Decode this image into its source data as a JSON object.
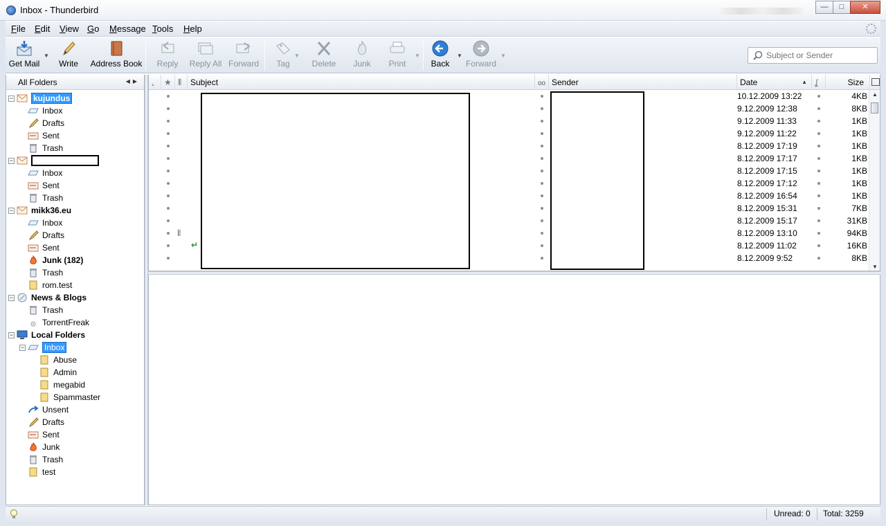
{
  "window": {
    "title": "Inbox - Thunderbird",
    "buttons": {
      "minimize": "—",
      "maximize": "□",
      "close": "✕"
    }
  },
  "menu": [
    {
      "label_u": "F",
      "label_rest": "ile"
    },
    {
      "label_u": "E",
      "label_rest": "dit"
    },
    {
      "label_u": "V",
      "label_rest": "iew"
    },
    {
      "label_u": "G",
      "label_rest": "o"
    },
    {
      "label_u": "M",
      "label_rest": "essage"
    },
    {
      "label_u": "T",
      "label_rest": "ools"
    },
    {
      "label_u": "H",
      "label_rest": "elp"
    }
  ],
  "toolbar": {
    "get_mail": "Get Mail",
    "write": "Write",
    "address_book": "Address Book",
    "reply": "Reply",
    "reply_all": "Reply All",
    "forward": "Forward",
    "tag": "Tag",
    "delete": "Delete",
    "junk": "Junk",
    "print": "Print",
    "back": "Back",
    "forward_nav": "Forward",
    "search_placeholder": "Subject or Sender"
  },
  "folder_pane": {
    "header": "All Folders",
    "tree": [
      {
        "label": "kujundus",
        "icon": "account-mail-icon",
        "bold": true,
        "selected_style": true
      },
      {
        "label": "Inbox",
        "icon": "inbox-icon"
      },
      {
        "label": "Drafts",
        "icon": "drafts-icon"
      },
      {
        "label": "Sent",
        "icon": "sent-icon"
      },
      {
        "label": "Trash",
        "icon": "trash-icon"
      },
      {
        "label": "",
        "icon": "account-mail-icon",
        "redacted": true
      },
      {
        "label": "Inbox",
        "icon": "inbox-icon"
      },
      {
        "label": "Sent",
        "icon": "sent-icon"
      },
      {
        "label": "Trash",
        "icon": "trash-icon"
      },
      {
        "label": "mikk36.eu",
        "icon": "account-mail-icon",
        "bold": true
      },
      {
        "label": "Inbox",
        "icon": "inbox-icon"
      },
      {
        "label": "Drafts",
        "icon": "drafts-icon"
      },
      {
        "label": "Sent",
        "icon": "sent-icon"
      },
      {
        "label": "Junk (182)",
        "icon": "junk-icon",
        "bold": true
      },
      {
        "label": "Trash",
        "icon": "trash-icon"
      },
      {
        "label": "rom.test",
        "icon": "folder-icon"
      },
      {
        "label": "News & Blogs",
        "icon": "news-icon",
        "bold": true
      },
      {
        "label": "Trash",
        "icon": "trash-icon"
      },
      {
        "label": "TorrentFreak",
        "icon": "rss-icon"
      },
      {
        "label": "Local Folders",
        "icon": "computer-icon",
        "bold": true
      },
      {
        "label": "Inbox",
        "icon": "inbox-icon",
        "selected": true
      },
      {
        "label": "Abuse",
        "icon": "folder-icon"
      },
      {
        "label": "Admin",
        "icon": "folder-icon"
      },
      {
        "label": "megabid",
        "icon": "folder-icon"
      },
      {
        "label": "Spammaster",
        "icon": "folder-icon"
      },
      {
        "label": "Unsent",
        "icon": "unsent-icon"
      },
      {
        "label": "Drafts",
        "icon": "drafts-icon"
      },
      {
        "label": "Sent",
        "icon": "sent-icon"
      },
      {
        "label": "Junk",
        "icon": "junk-icon"
      },
      {
        "label": "Trash",
        "icon": "trash-icon"
      },
      {
        "label": "test",
        "icon": "folder-icon"
      }
    ]
  },
  "thread_pane": {
    "columns": {
      "subject": "Subject",
      "sender": "Sender",
      "date": "Date",
      "size": "Size"
    },
    "messages": [
      {
        "date": "10.12.2009 13:22",
        "size": "4KB"
      },
      {
        "date": "9.12.2009 12:38",
        "size": "8KB"
      },
      {
        "date": "9.12.2009 11:33",
        "size": "1KB"
      },
      {
        "date": "9.12.2009 11:22",
        "size": "1KB"
      },
      {
        "date": "8.12.2009 17:19",
        "size": "1KB"
      },
      {
        "date": "8.12.2009 17:17",
        "size": "1KB"
      },
      {
        "date": "8.12.2009 17:15",
        "size": "1KB"
      },
      {
        "date": "8.12.2009 17:12",
        "size": "1KB"
      },
      {
        "date": "8.12.2009 16:54",
        "size": "1KB"
      },
      {
        "date": "8.12.2009 15:31",
        "size": "7KB"
      },
      {
        "date": "8.12.2009 15:17",
        "size": "31KB"
      },
      {
        "date": "8.12.2009 13:10",
        "size": "94KB",
        "attachment": true
      },
      {
        "date": "8.12.2009 11:02",
        "size": "16KB",
        "replied": true
      },
      {
        "date": "8.12.2009 9:52",
        "size": "8KB"
      }
    ]
  },
  "statusbar": {
    "unread": "Unread: 0",
    "total": "Total: 3259"
  },
  "colors": {
    "selection": "#3399ff",
    "chrome": "#dfe6ef"
  }
}
